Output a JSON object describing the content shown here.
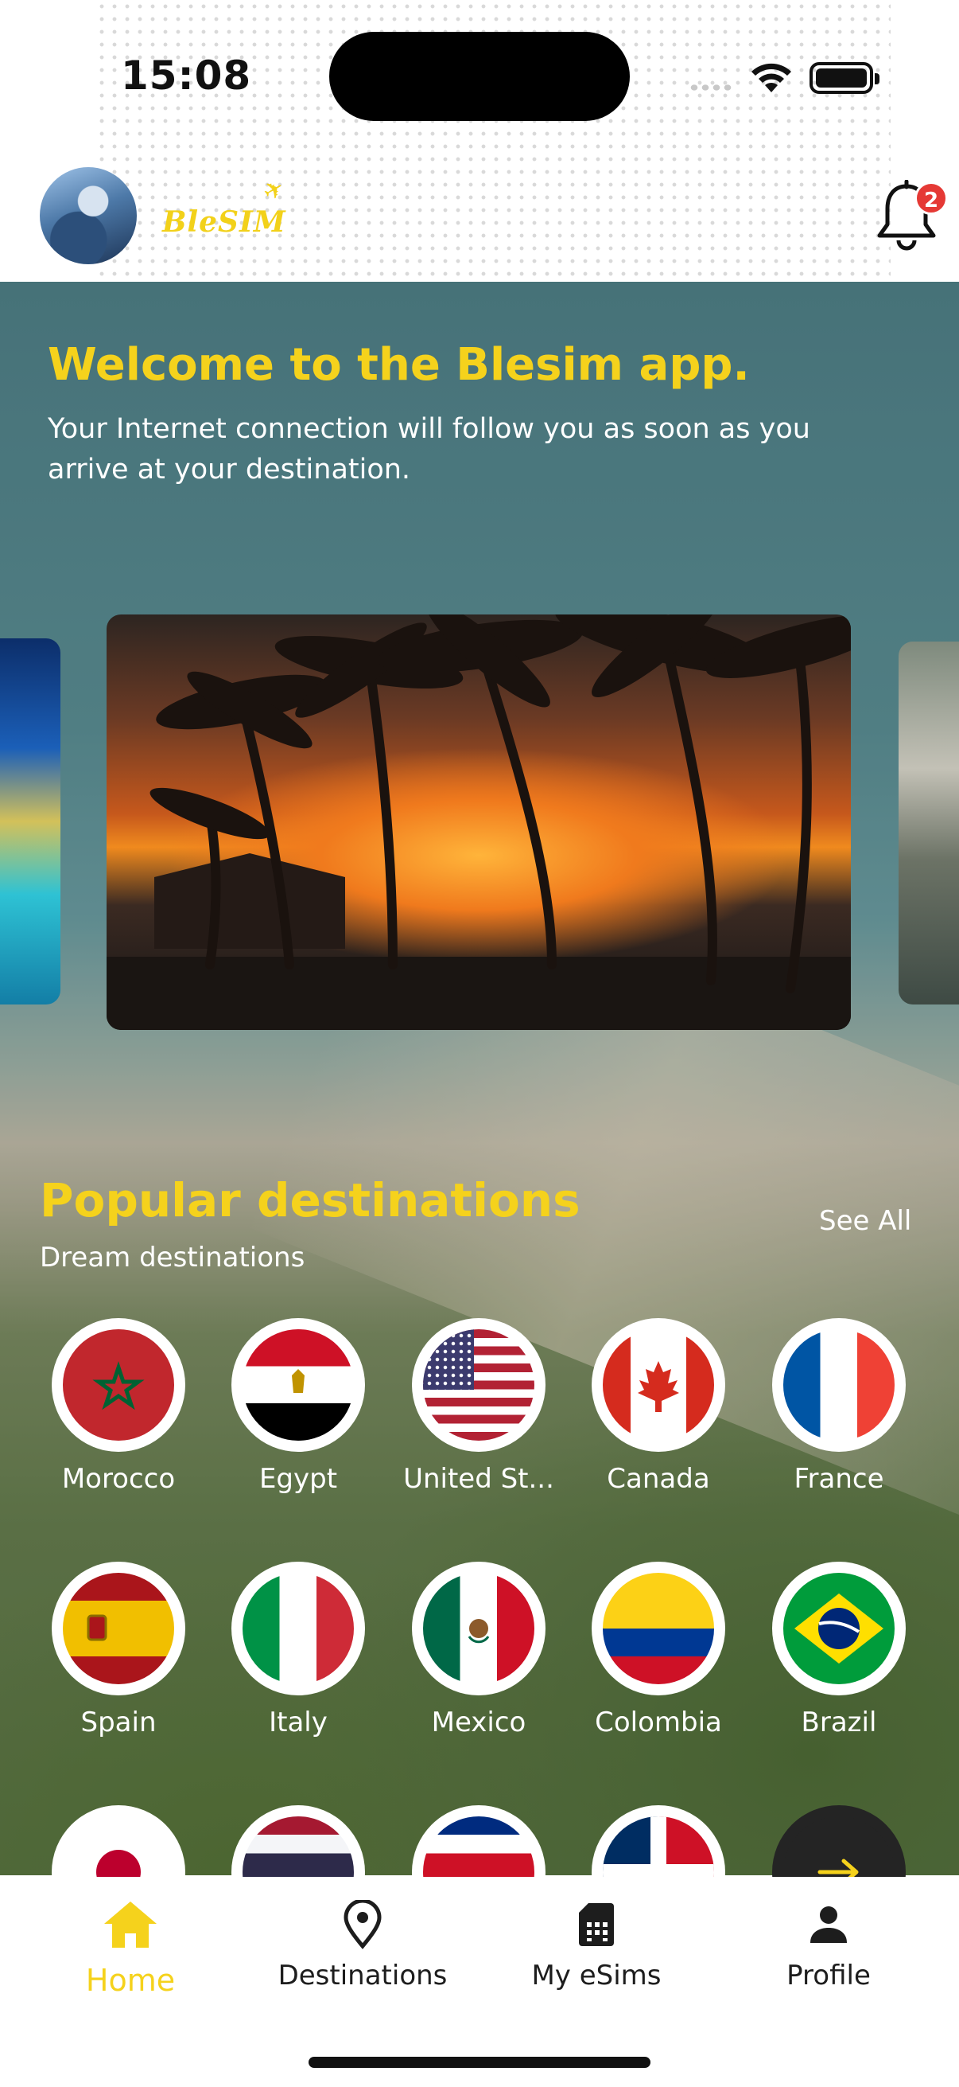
{
  "status_bar": {
    "time": "15:08"
  },
  "header": {
    "logo_text": "BleSIM",
    "notification_count": "2"
  },
  "welcome": {
    "title": "Welcome to the Blesim app.",
    "subtitle": "Your Internet connection will follow you as soon as you arrive at your destination."
  },
  "carousel": {
    "active_index": 0,
    "page_count": 3
  },
  "popular": {
    "title": "Popular destinations",
    "subtitle": "Dream destinations",
    "see_all_label": "See All",
    "destinations": [
      {
        "name": "Morocco"
      },
      {
        "name": "Egypt"
      },
      {
        "name": "United St..."
      },
      {
        "name": "Canada"
      },
      {
        "name": "France"
      },
      {
        "name": "Spain"
      },
      {
        "name": "Italy"
      },
      {
        "name": "Mexico"
      },
      {
        "name": "Colombia"
      },
      {
        "name": "Brazil"
      }
    ]
  },
  "tabbar": {
    "items": [
      {
        "label": "Home",
        "icon": "home-icon",
        "active": true
      },
      {
        "label": "Destinations",
        "icon": "location-pin-icon",
        "active": false
      },
      {
        "label": "My eSims",
        "icon": "sim-card-icon",
        "active": false
      },
      {
        "label": "Profile",
        "icon": "person-icon",
        "active": false
      }
    ]
  },
  "colors": {
    "accent": "#F5D21C",
    "badge": "#E53935",
    "dark": "#1D1D1D"
  }
}
